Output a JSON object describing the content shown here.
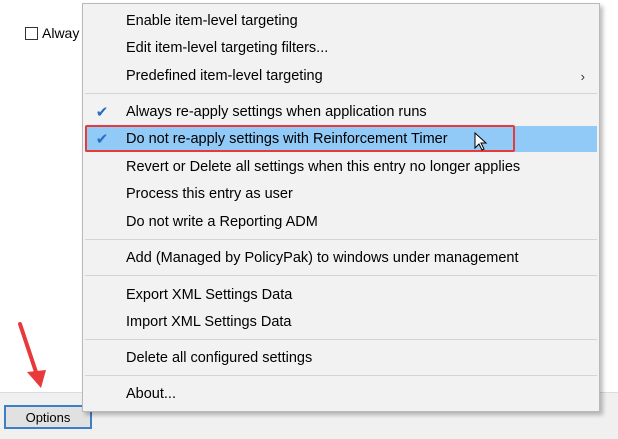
{
  "background": {
    "checkbox_label": "Alway"
  },
  "options_button": {
    "label": "Options"
  },
  "menu": {
    "items": [
      {
        "label": "Enable item-level targeting"
      },
      {
        "label": "Edit item-level targeting filters..."
      },
      {
        "label": "Predefined item-level targeting",
        "submenu_arrow": "›"
      },
      {
        "label": "Always re-apply settings when application runs",
        "checked": true
      },
      {
        "label": "Do not re-apply settings with Reinforcement Timer",
        "checked": true,
        "highlighted": true
      },
      {
        "label": "Revert or Delete all settings when this entry no longer applies"
      },
      {
        "label": "Process this entry as user"
      },
      {
        "label": "Do not write a Reporting ADM"
      },
      {
        "label": "Add (Managed by PolicyPak) to windows under management"
      },
      {
        "label": "Export XML Settings Data"
      },
      {
        "label": "Import XML Settings Data"
      },
      {
        "label": "Delete all configured settings"
      },
      {
        "label": "About..."
      }
    ],
    "check_glyph": "✔"
  },
  "colors": {
    "highlight": "#91c9f7",
    "annotation_red": "#e8393b",
    "check_blue": "#2a6cc0"
  }
}
